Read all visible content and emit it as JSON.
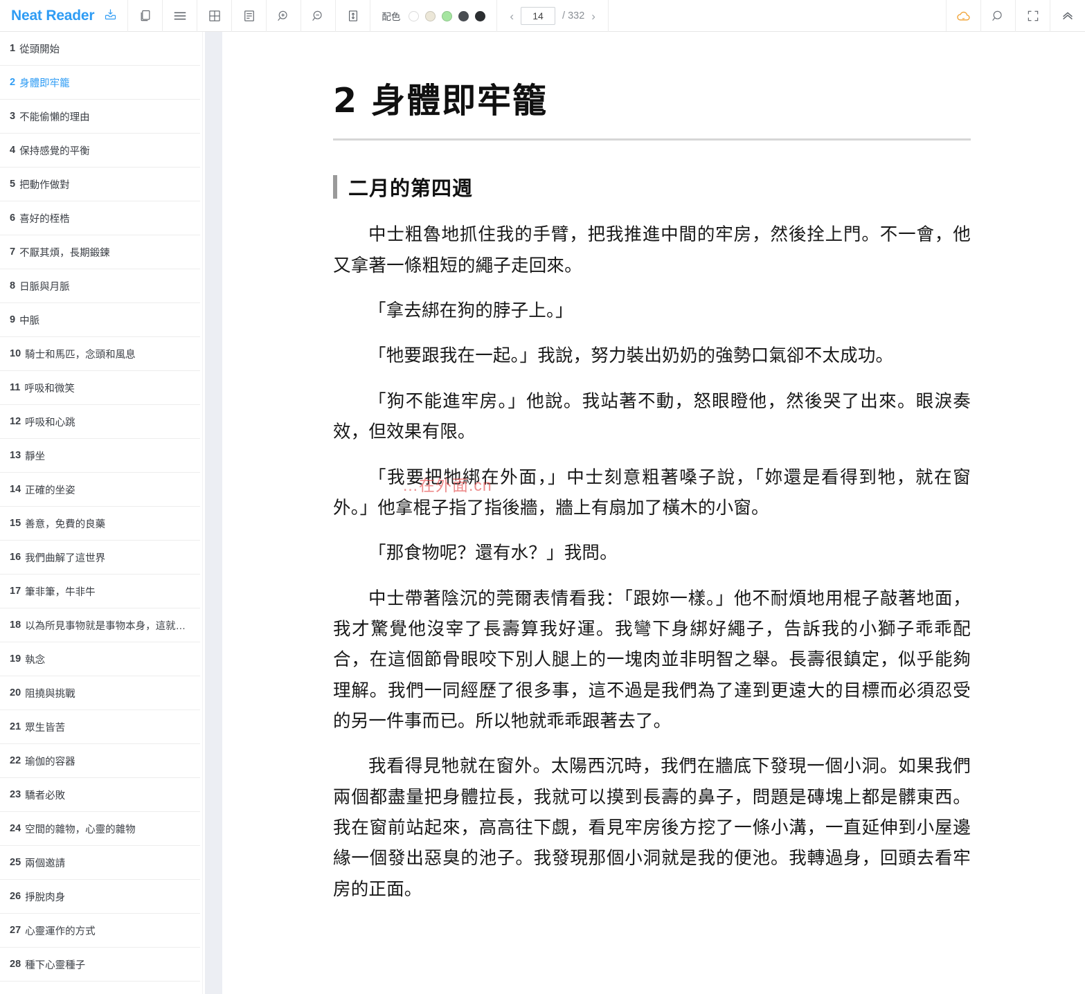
{
  "toolbar": {
    "brand": "Neat Reader",
    "icons": [
      {
        "name": "save-to-library-icon"
      },
      {
        "name": "two-page-view-icon"
      },
      {
        "name": "menu-icon"
      },
      {
        "name": "grid-view-icon"
      },
      {
        "name": "text-layout-icon"
      },
      {
        "name": "zoom-in-icon"
      },
      {
        "name": "zoom-out-icon"
      },
      {
        "name": "line-height-icon"
      }
    ],
    "palette": {
      "label": "配色",
      "swatches": [
        "#ffffff",
        "#ece7d8",
        "#a5e5a0",
        "#494d52",
        "#2b2e31"
      ],
      "selected_index": 0
    },
    "pager": {
      "prev_label": "‹",
      "next_label": "›",
      "current_page": "14",
      "total_label": "/ 332"
    },
    "right_icons": [
      {
        "name": "cloud-sync-icon",
        "color": "#f0a132"
      },
      {
        "name": "search-icon"
      },
      {
        "name": "fullscreen-icon"
      },
      {
        "name": "collapse-toolbar-icon"
      }
    ]
  },
  "sidebar": {
    "items": [
      {
        "num": "1",
        "label": "從頭開始",
        "active": false
      },
      {
        "num": "2",
        "label": "身體即牢籠",
        "active": true
      },
      {
        "num": "3",
        "label": "不能偷懶的理由",
        "active": false
      },
      {
        "num": "4",
        "label": "保持感覺的平衡",
        "active": false
      },
      {
        "num": "5",
        "label": "把動作做對",
        "active": false
      },
      {
        "num": "6",
        "label": "喜好的桎梏",
        "active": false
      },
      {
        "num": "7",
        "label": "不厭其煩，長期鍛鍊",
        "active": false
      },
      {
        "num": "8",
        "label": "日脈與月脈",
        "active": false
      },
      {
        "num": "9",
        "label": "中脈",
        "active": false
      },
      {
        "num": "10",
        "label": "騎士和馬匹，念頭和風息",
        "active": false
      },
      {
        "num": "11",
        "label": "呼吸和微笑",
        "active": false
      },
      {
        "num": "12",
        "label": "呼吸和心跳",
        "active": false
      },
      {
        "num": "13",
        "label": "靜坐",
        "active": false
      },
      {
        "num": "14",
        "label": "正確的坐姿",
        "active": false
      },
      {
        "num": "15",
        "label": "善意，免費的良藥",
        "active": false
      },
      {
        "num": "16",
        "label": "我們曲解了這世界",
        "active": false
      },
      {
        "num": "17",
        "label": "筆非筆，牛非牛",
        "active": false
      },
      {
        "num": "18",
        "label": "以為所見事物就是事物本身，這就…",
        "active": false
      },
      {
        "num": "19",
        "label": "執念",
        "active": false
      },
      {
        "num": "20",
        "label": "阻撓與挑戰",
        "active": false
      },
      {
        "num": "21",
        "label": "眾生皆苦",
        "active": false
      },
      {
        "num": "22",
        "label": "瑜伽的容器",
        "active": false
      },
      {
        "num": "23",
        "label": "驕者必敗",
        "active": false
      },
      {
        "num": "24",
        "label": "空間的雜物，心靈的雜物",
        "active": false
      },
      {
        "num": "25",
        "label": "兩個邀請",
        "active": false
      },
      {
        "num": "26",
        "label": "掙脫肉身",
        "active": false
      },
      {
        "num": "27",
        "label": "心靈運作的方式",
        "active": false
      },
      {
        "num": "28",
        "label": "種下心靈種子",
        "active": false
      }
    ]
  },
  "main": {
    "chapter_title": "2 身體即牢籠",
    "section_title": "二月的第四週",
    "watermark": "…在外面.cn",
    "paragraphs": [
      "中士粗魯地抓住我的手臂，把我推進中間的牢房，然後拴上門。不一會，他又拿著一條粗短的繩子走回來。",
      "「拿去綁在狗的脖子上。」",
      "「牠要跟我在一起。」我說，努力裝出奶奶的強勢口氣卻不太成功。",
      "「狗不能進牢房。」他說。我站著不動，怒眼瞪他，然後哭了出來。眼淚奏效，但效果有限。",
      "「我要把牠綁在外面，」中士刻意粗著嗓子說，「妳還是看得到牠，就在窗外。」他拿棍子指了指後牆，牆上有扇加了橫木的小窗。",
      "「那食物呢？還有水？」我問。",
      "中士帶著陰沉的莞爾表情看我：「跟妳一樣。」他不耐煩地用棍子敲著地面，我才驚覺他沒宰了長壽算我好運。我彎下身綁好繩子，告訴我的小獅子乖乖配合，在這個節骨眼咬下別人腿上的一塊肉並非明智之舉。長壽很鎮定，似乎能夠理解。我們一同經歷了很多事，這不過是我們為了達到更遠大的目標而必須忍受的另一件事而已。所以牠就乖乖跟著去了。",
      "我看得見牠就在窗外。太陽西沉時，我們在牆底下發現一個小洞。如果我們兩個都盡量把身體拉長，我就可以摸到長壽的鼻子，問題是磚塊上都是髒東西。我在窗前站起來，高高往下覷，看見牢房後方挖了一條小溝，一直延伸到小屋邊緣一個發出惡臭的池子。我發現那個小洞就是我的便池。我轉過身，回頭去看牢房的正面。"
    ]
  }
}
